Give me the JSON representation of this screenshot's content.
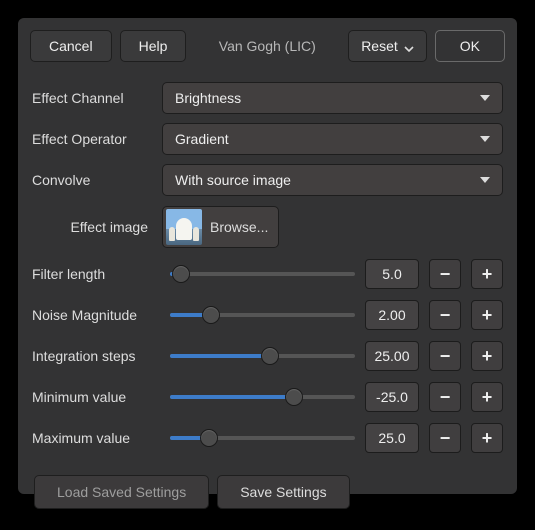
{
  "toolbar": {
    "cancel": "Cancel",
    "help": "Help",
    "title": "Van Gogh (LIC)",
    "reset": "Reset",
    "ok": "OK"
  },
  "fields": {
    "effect_channel": {
      "label": "Effect Channel",
      "value": "Brightness"
    },
    "effect_operator": {
      "label": "Effect Operator",
      "value": "Gradient"
    },
    "convolve": {
      "label": "Convolve",
      "value": "With source image"
    },
    "effect_image": {
      "label": "Effect image",
      "action": "Browse..."
    }
  },
  "sliders": {
    "filter_length": {
      "label": "Filter length",
      "display": "5.0",
      "pct": 6
    },
    "noise_magnitude": {
      "label": "Noise Magnitude",
      "display": "2.00",
      "pct": 22
    },
    "integration_steps": {
      "label": "Integration steps",
      "display": "25.00",
      "pct": 54
    },
    "minimum_value": {
      "label": "Minimum value",
      "display": "-25.0",
      "pct": 67
    },
    "maximum_value": {
      "label": "Maximum value",
      "display": "25.0",
      "pct": 21
    }
  },
  "footer": {
    "load": "Load Saved Settings",
    "save": "Save Settings"
  }
}
